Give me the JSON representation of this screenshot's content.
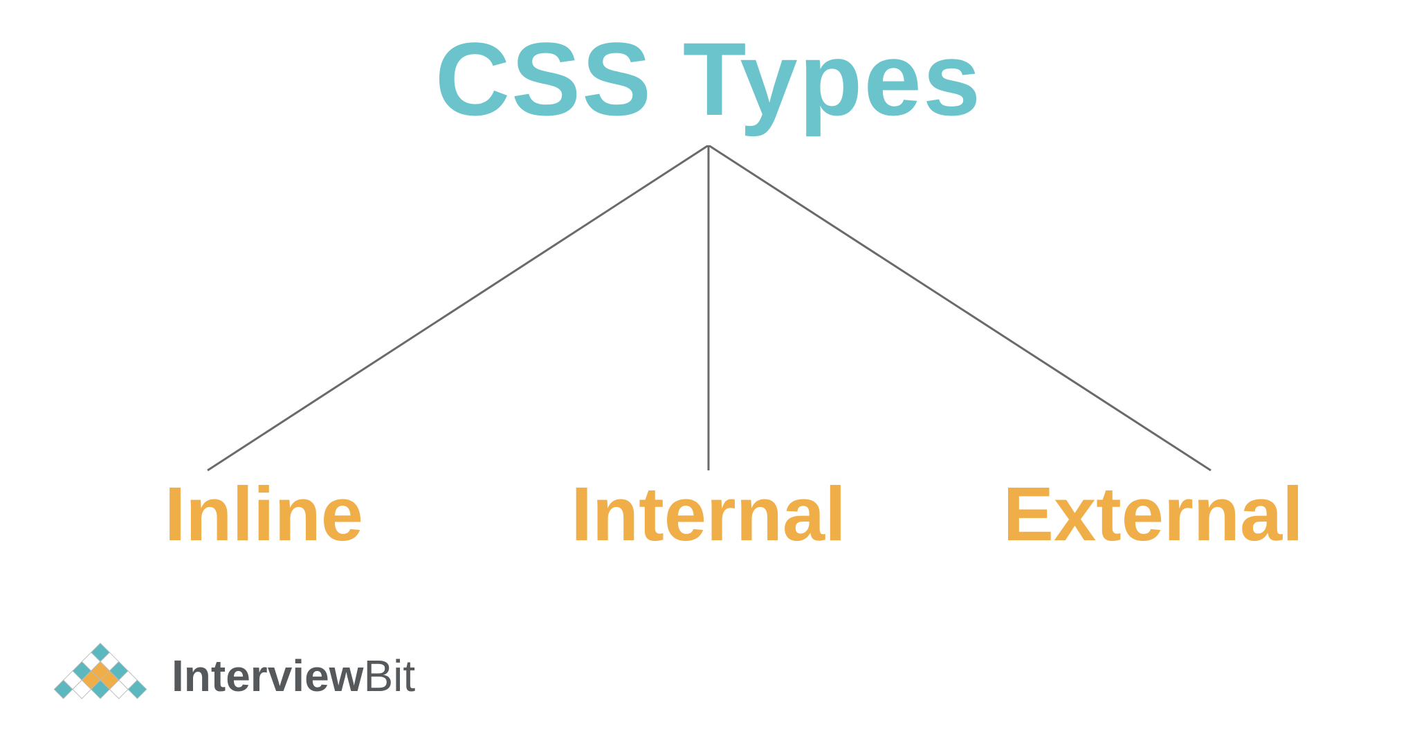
{
  "diagram": {
    "title": "CSS Types",
    "children": [
      "Inline",
      "Internal",
      "External"
    ]
  },
  "branding": {
    "name_bold": "Interview",
    "name_light": "Bit"
  },
  "colors": {
    "title": "#6BC4CB",
    "child": "#F0AE48",
    "connector": "#6A6A6A",
    "logo_text": "#56595C",
    "logo_teal": "#5CB8BF",
    "logo_orange": "#F0AE48",
    "logo_white": "#FFFFFF",
    "logo_stroke": "#B9BBBD"
  }
}
